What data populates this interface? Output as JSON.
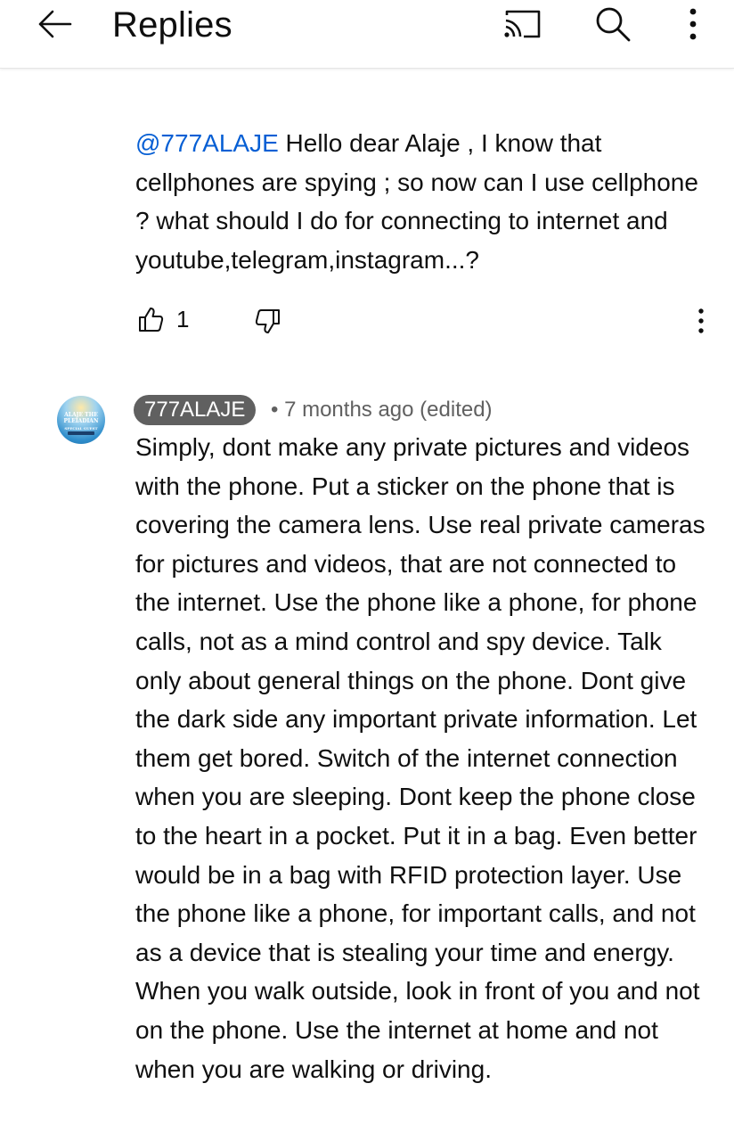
{
  "header": {
    "title": "Replies",
    "back_icon": "arrow-left-icon",
    "actions": [
      "cast-icon",
      "search-icon",
      "more-vertical-icon"
    ]
  },
  "reply_1": {
    "mention": "@777ALAJE",
    "text": " Hello dear Alaje , I know that cellphones are spying ; so now can I use cellphone ? what should I do for connecting to internet and youtube,telegram,instagram...?",
    "like_count": "1"
  },
  "reply_2": {
    "author": "777ALAJE",
    "meta": "• 7 months ago (edited)",
    "avatar_text": [
      "ALAJE THE",
      "PLEIADIAN",
      "SPECIAL GUEST"
    ],
    "text": "Simply, dont make any private pictures and videos with the phone. Put a sticker on the phone that is covering the camera lens. Use real private cameras for pictures and videos, that are not connected to the internet. Use the phone like a phone, for phone calls, not as a mind control and spy device. Talk only about general things on the phone. Dont give the dark side any important private information. Let them get bored. Switch of the internet connection when you are sleeping. Dont keep the phone close to the heart in a pocket. Put it in a bag. Even better would be in a bag with RFID protection layer. Use the phone like a phone, for important calls, and not as a device that is stealing your time and energy. When you walk outside, look in front of you and not on the phone. Use the internet at home and not when you are walking or driving."
  },
  "colors": {
    "text": "#0f0f0f",
    "secondary": "#606060",
    "mention": "#065fd4",
    "chip": "#606060"
  }
}
